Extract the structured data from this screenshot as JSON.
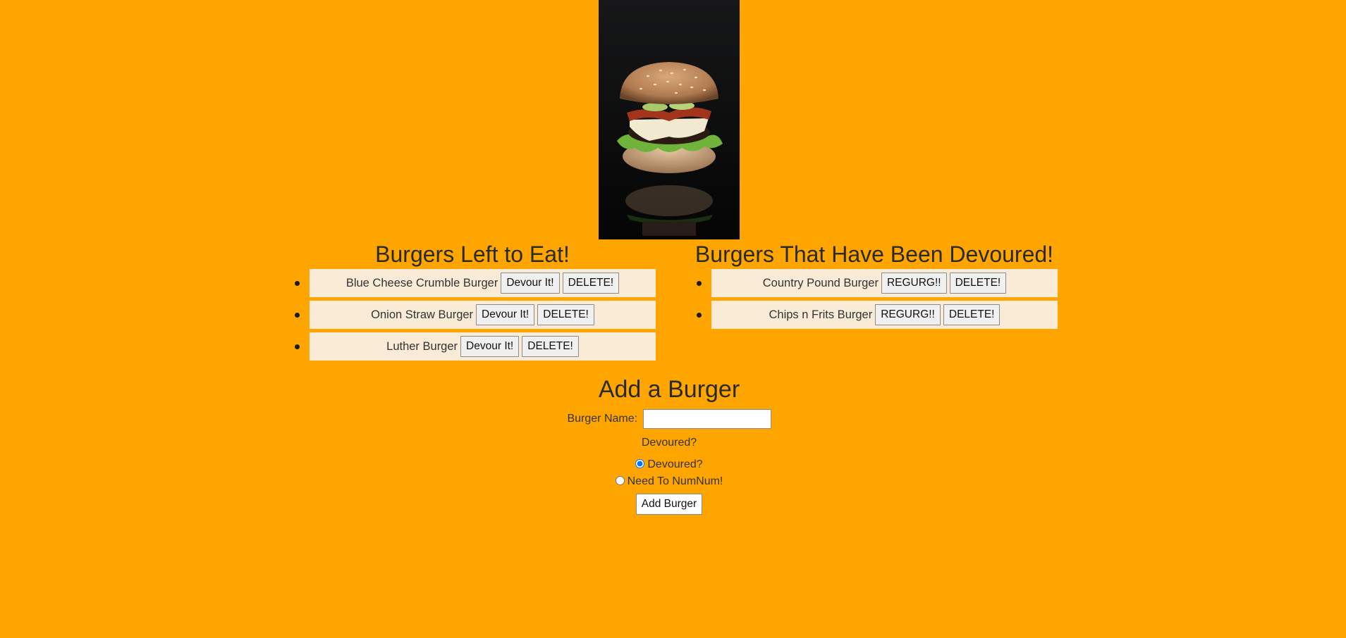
{
  "pending": {
    "heading": "Burgers Left to Eat!",
    "items": [
      {
        "name": "Blue Cheese Crumble Burger",
        "action": "Devour It!",
        "delete": "DELETE!"
      },
      {
        "name": "Onion Straw Burger",
        "action": "Devour It!",
        "delete": "DELETE!"
      },
      {
        "name": "Luther Burger",
        "action": "Devour It!",
        "delete": "DELETE!"
      }
    ]
  },
  "devoured": {
    "heading": "Burgers That Have Been Devoured!",
    "items": [
      {
        "name": "Country Pound Burger",
        "action": "REGURG!!",
        "delete": "DELETE!"
      },
      {
        "name": "Chips n Frits Burger",
        "action": "REGURG!!",
        "delete": "DELETE!"
      }
    ]
  },
  "form": {
    "heading": "Add a Burger",
    "name_label": "Burger Name:",
    "name_value": "",
    "question": "Devoured?",
    "radio_devoured": "Devoured?",
    "radio_need": "Need To NumNum!",
    "submit": "Add Burger"
  },
  "colors": {
    "background": "#ffa500",
    "list_item": "#faebd7"
  }
}
